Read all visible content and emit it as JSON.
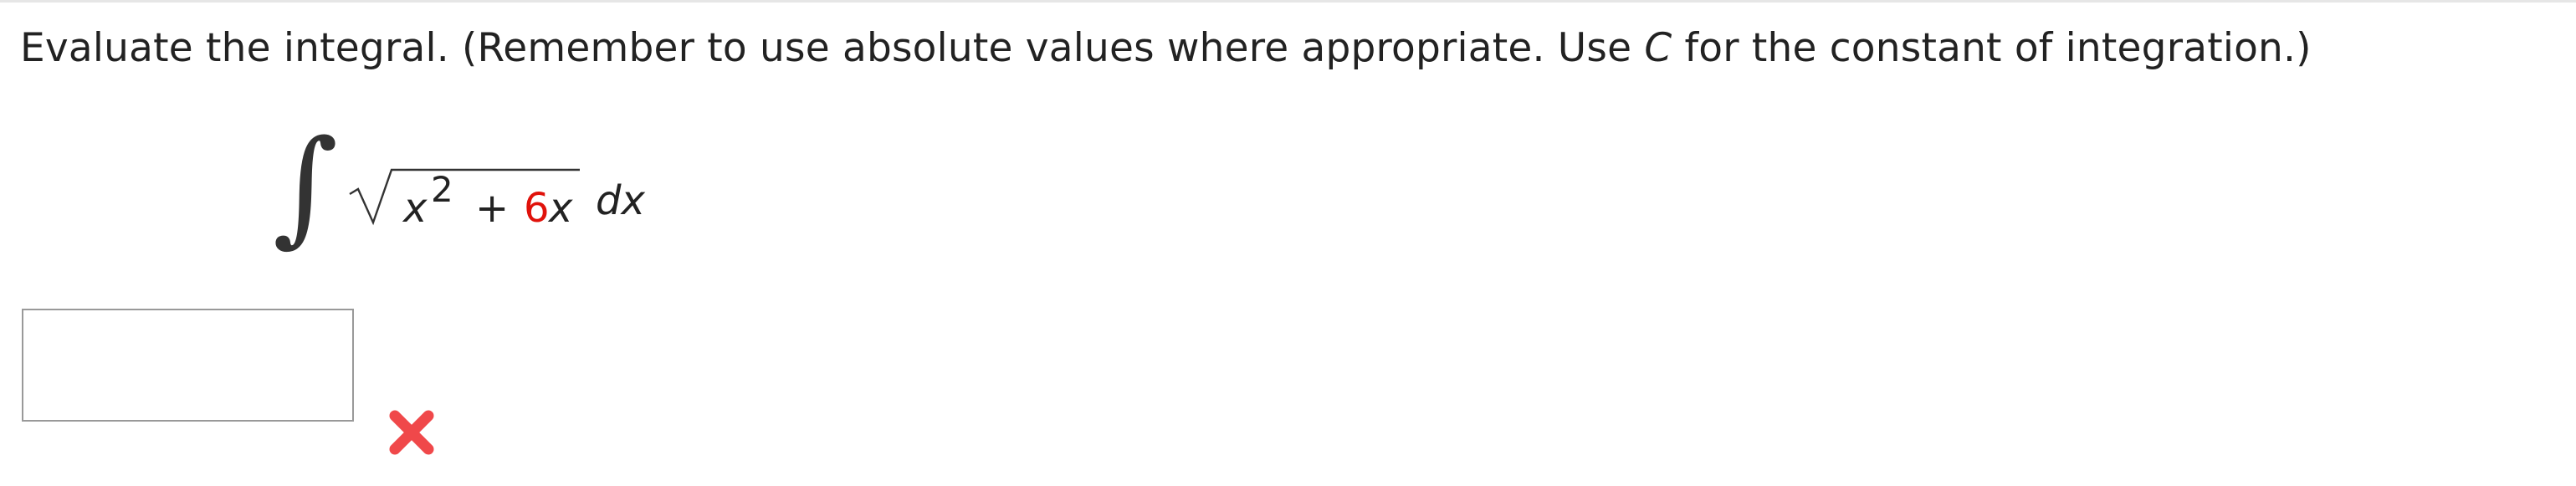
{
  "question": {
    "prompt_before_c": "Evaluate the integral. (Remember to use absolute values where appropriate. Use ",
    "constant_symbol": "C",
    "prompt_after_c": " for the constant of integration.)"
  },
  "integral": {
    "integral_symbol": "∫",
    "var": "x",
    "exponent": "2",
    "plus": "+",
    "coefficient": "6",
    "var2": "x",
    "differential": "dx"
  },
  "answer": {
    "value": "",
    "placeholder": ""
  },
  "feedback": {
    "status": "incorrect",
    "icon": "x-mark-icon",
    "color": "#f0484a"
  }
}
